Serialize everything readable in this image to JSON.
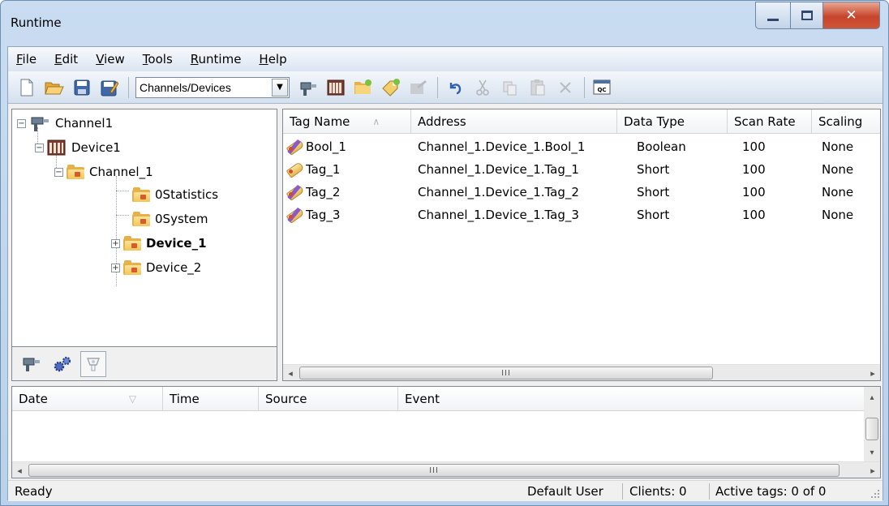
{
  "window": {
    "title": "Runtime"
  },
  "menu": {
    "items": [
      {
        "underline": "F",
        "rest": "ile"
      },
      {
        "underline": "E",
        "rest": "dit"
      },
      {
        "underline": "V",
        "rest": "iew"
      },
      {
        "underline": "T",
        "rest": "ools"
      },
      {
        "underline": "R",
        "rest": "untime"
      },
      {
        "underline": "H",
        "rest": "elp"
      }
    ]
  },
  "toolbar": {
    "view_combo": "Channels/Devices",
    "icons": [
      "new-icon",
      "open-icon",
      "save-icon",
      "save-as-icon",
      "new-channel-icon",
      "new-device-icon",
      "new-group-icon",
      "new-tag-icon",
      "bulk-edit-icon",
      "undo-icon",
      "cut-icon",
      "copy-icon",
      "paste-icon",
      "delete-icon",
      "quick-client-icon"
    ],
    "qc_label": "QC"
  },
  "tree": {
    "root": "Channel1",
    "device": "Device1",
    "channel": "Channel_1",
    "folders": [
      "0Statistics",
      "0System",
      "Device_1",
      "Device_2"
    ]
  },
  "tag_table": {
    "columns": [
      "Tag Name",
      "Address",
      "Data Type",
      "Scan Rate",
      "Scaling"
    ],
    "rows": [
      {
        "name": "Bool_1",
        "address": "Channel_1.Device_1.Bool_1",
        "type": "Boolean",
        "scan": "100",
        "scaling": "None"
      },
      {
        "name": "Tag_1",
        "address": "Channel_1.Device_1.Tag_1",
        "type": "Short",
        "scan": "100",
        "scaling": "None"
      },
      {
        "name": "Tag_2",
        "address": "Channel_1.Device_1.Tag_2",
        "type": "Short",
        "scan": "100",
        "scaling": "None"
      },
      {
        "name": "Tag_3",
        "address": "Channel_1.Device_1.Tag_3",
        "type": "Short",
        "scan": "100",
        "scaling": "None"
      }
    ]
  },
  "event_log": {
    "columns": [
      "Date",
      "Time",
      "Source",
      "Event"
    ]
  },
  "scroll_grip": "III",
  "status": {
    "ready": "Ready",
    "user": "Default User",
    "clients": "Clients: 0",
    "active_tags": "Active tags: 0 of 0"
  },
  "colors": {
    "title_bar": "#c9dcf1",
    "close_button": "#c7442b",
    "folder": "#f1c55a"
  }
}
